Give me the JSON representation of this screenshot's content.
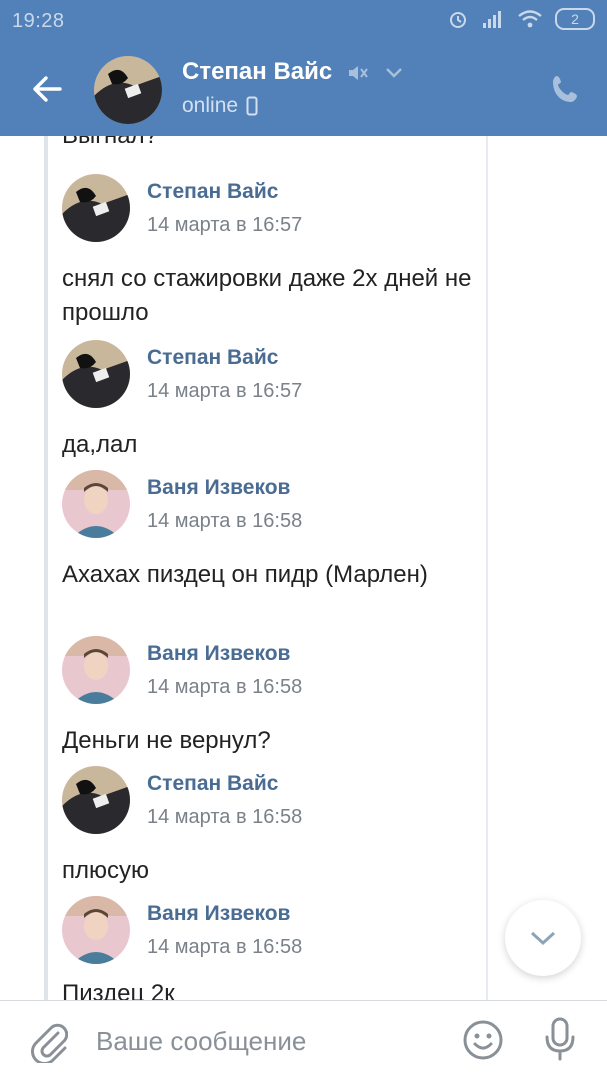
{
  "status_bar": {
    "time": "19:28",
    "battery": "2"
  },
  "header": {
    "contact_name": "Степан Вайс",
    "status": "online",
    "icons": [
      "back-arrow-icon",
      "muted-speaker-icon",
      "chevron-down-icon",
      "mobile-device-icon",
      "phone-icon"
    ]
  },
  "feed": {
    "partial_top_text": "Выгнал?",
    "messages": [
      {
        "author": "Степан Вайс",
        "date": "14 марта в 16:57",
        "text": "снял со стажировки даже 2х дней не прошло",
        "avatar": "stepan"
      },
      {
        "author": "Степан Вайс",
        "date": "14 марта в 16:57",
        "text": "да,лал",
        "avatar": "stepan"
      },
      {
        "author": "Ваня Извеков",
        "date": "14 марта в 16:58",
        "text": "Ахахах пиздец он пидр (Марлен)",
        "avatar": "vanya"
      },
      {
        "author": "Ваня Извеков",
        "date": "14 марта в 16:58",
        "text": "Деньги не вернул?",
        "avatar": "vanya"
      },
      {
        "author": "Степан Вайс",
        "date": "14 марта в 16:58",
        "text": "плюсую",
        "avatar": "stepan"
      },
      {
        "author": "Ваня Извеков",
        "date": "14 марта в 16:58",
        "text": "",
        "avatar": "vanya"
      }
    ],
    "partial_bottom_text": "Пиздец 2к"
  },
  "composer": {
    "placeholder": "Ваше сообщение"
  },
  "colors": {
    "header_bg": "#5181b8",
    "author": "#4a6c93",
    "date": "#7a8189"
  }
}
